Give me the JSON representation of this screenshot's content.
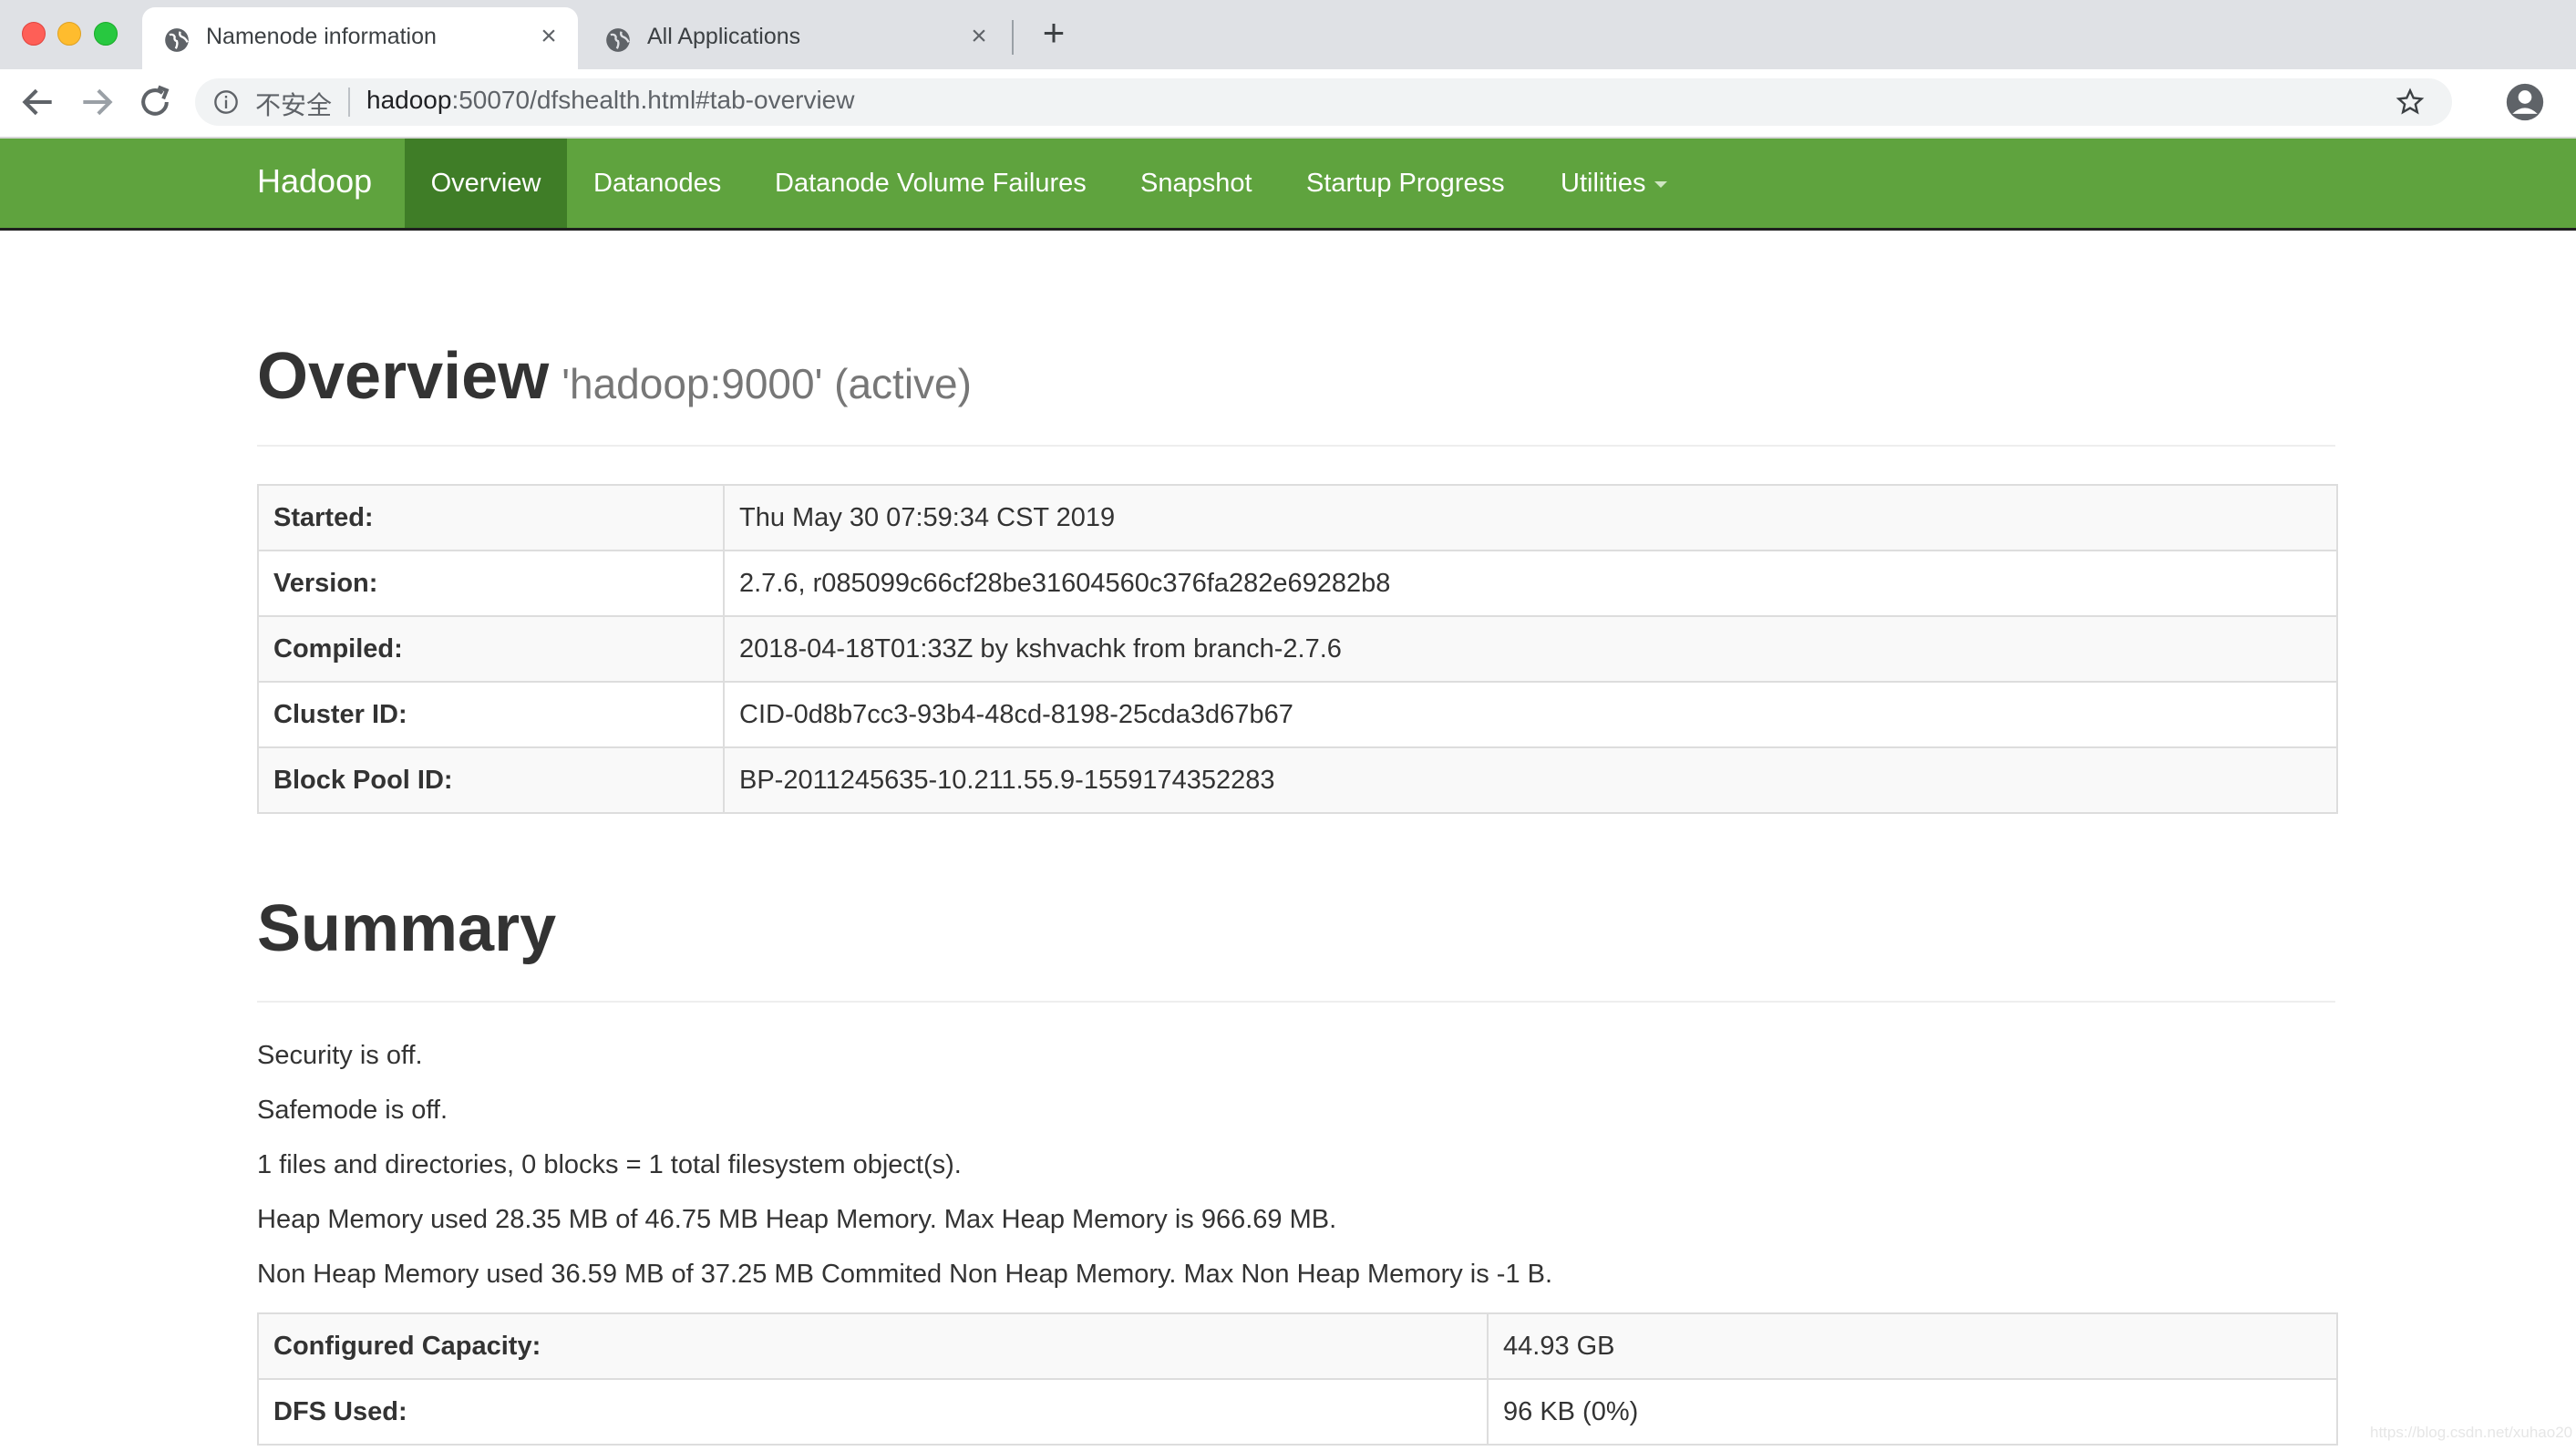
{
  "browser": {
    "tabs": [
      {
        "title": "Namenode information",
        "active": true
      },
      {
        "title": "All Applications",
        "active": false
      }
    ],
    "new_tab": "+",
    "close_glyph": "×",
    "insecure_label": "不安全",
    "url_host": "hadoop",
    "url_rest": ":50070/dfshealth.html#tab-overview"
  },
  "navbar": {
    "brand": "Hadoop",
    "items": [
      "Overview",
      "Datanodes",
      "Datanode Volume Failures",
      "Snapshot",
      "Startup Progress",
      "Utilities"
    ]
  },
  "overview": {
    "title": "Overview",
    "subtitle": "'hadoop:9000' (active)",
    "rows": [
      {
        "key": "Started:",
        "value": "Thu May 30 07:59:34 CST 2019"
      },
      {
        "key": "Version:",
        "value": "2.7.6, r085099c66cf28be31604560c376fa282e69282b8"
      },
      {
        "key": "Compiled:",
        "value": "2018-04-18T01:33Z by kshvachk from branch-2.7.6"
      },
      {
        "key": "Cluster ID:",
        "value": "CID-0d8b7cc3-93b4-48cd-8198-25cda3d67b67"
      },
      {
        "key": "Block Pool ID:",
        "value": "BP-2011245635-10.211.55.9-1559174352283"
      }
    ]
  },
  "summary": {
    "title": "Summary",
    "lines": [
      "Security is off.",
      "Safemode is off.",
      "1 files and directories, 0 blocks = 1 total filesystem object(s).",
      "Heap Memory used 28.35 MB of 46.75 MB Heap Memory. Max Heap Memory is 966.69 MB.",
      "Non Heap Memory used 36.59 MB of 37.25 MB Commited Non Heap Memory. Max Non Heap Memory is -1 B."
    ],
    "rows": [
      {
        "key": "Configured Capacity:",
        "value": "44.93 GB"
      },
      {
        "key": "DFS Used:",
        "value": "96 KB (0%)"
      }
    ]
  },
  "watermark": "https://blog.csdn.net/xuhao20",
  "colors": {
    "navbar": "#5fa33e",
    "navbar_active": "#3f7d27"
  }
}
